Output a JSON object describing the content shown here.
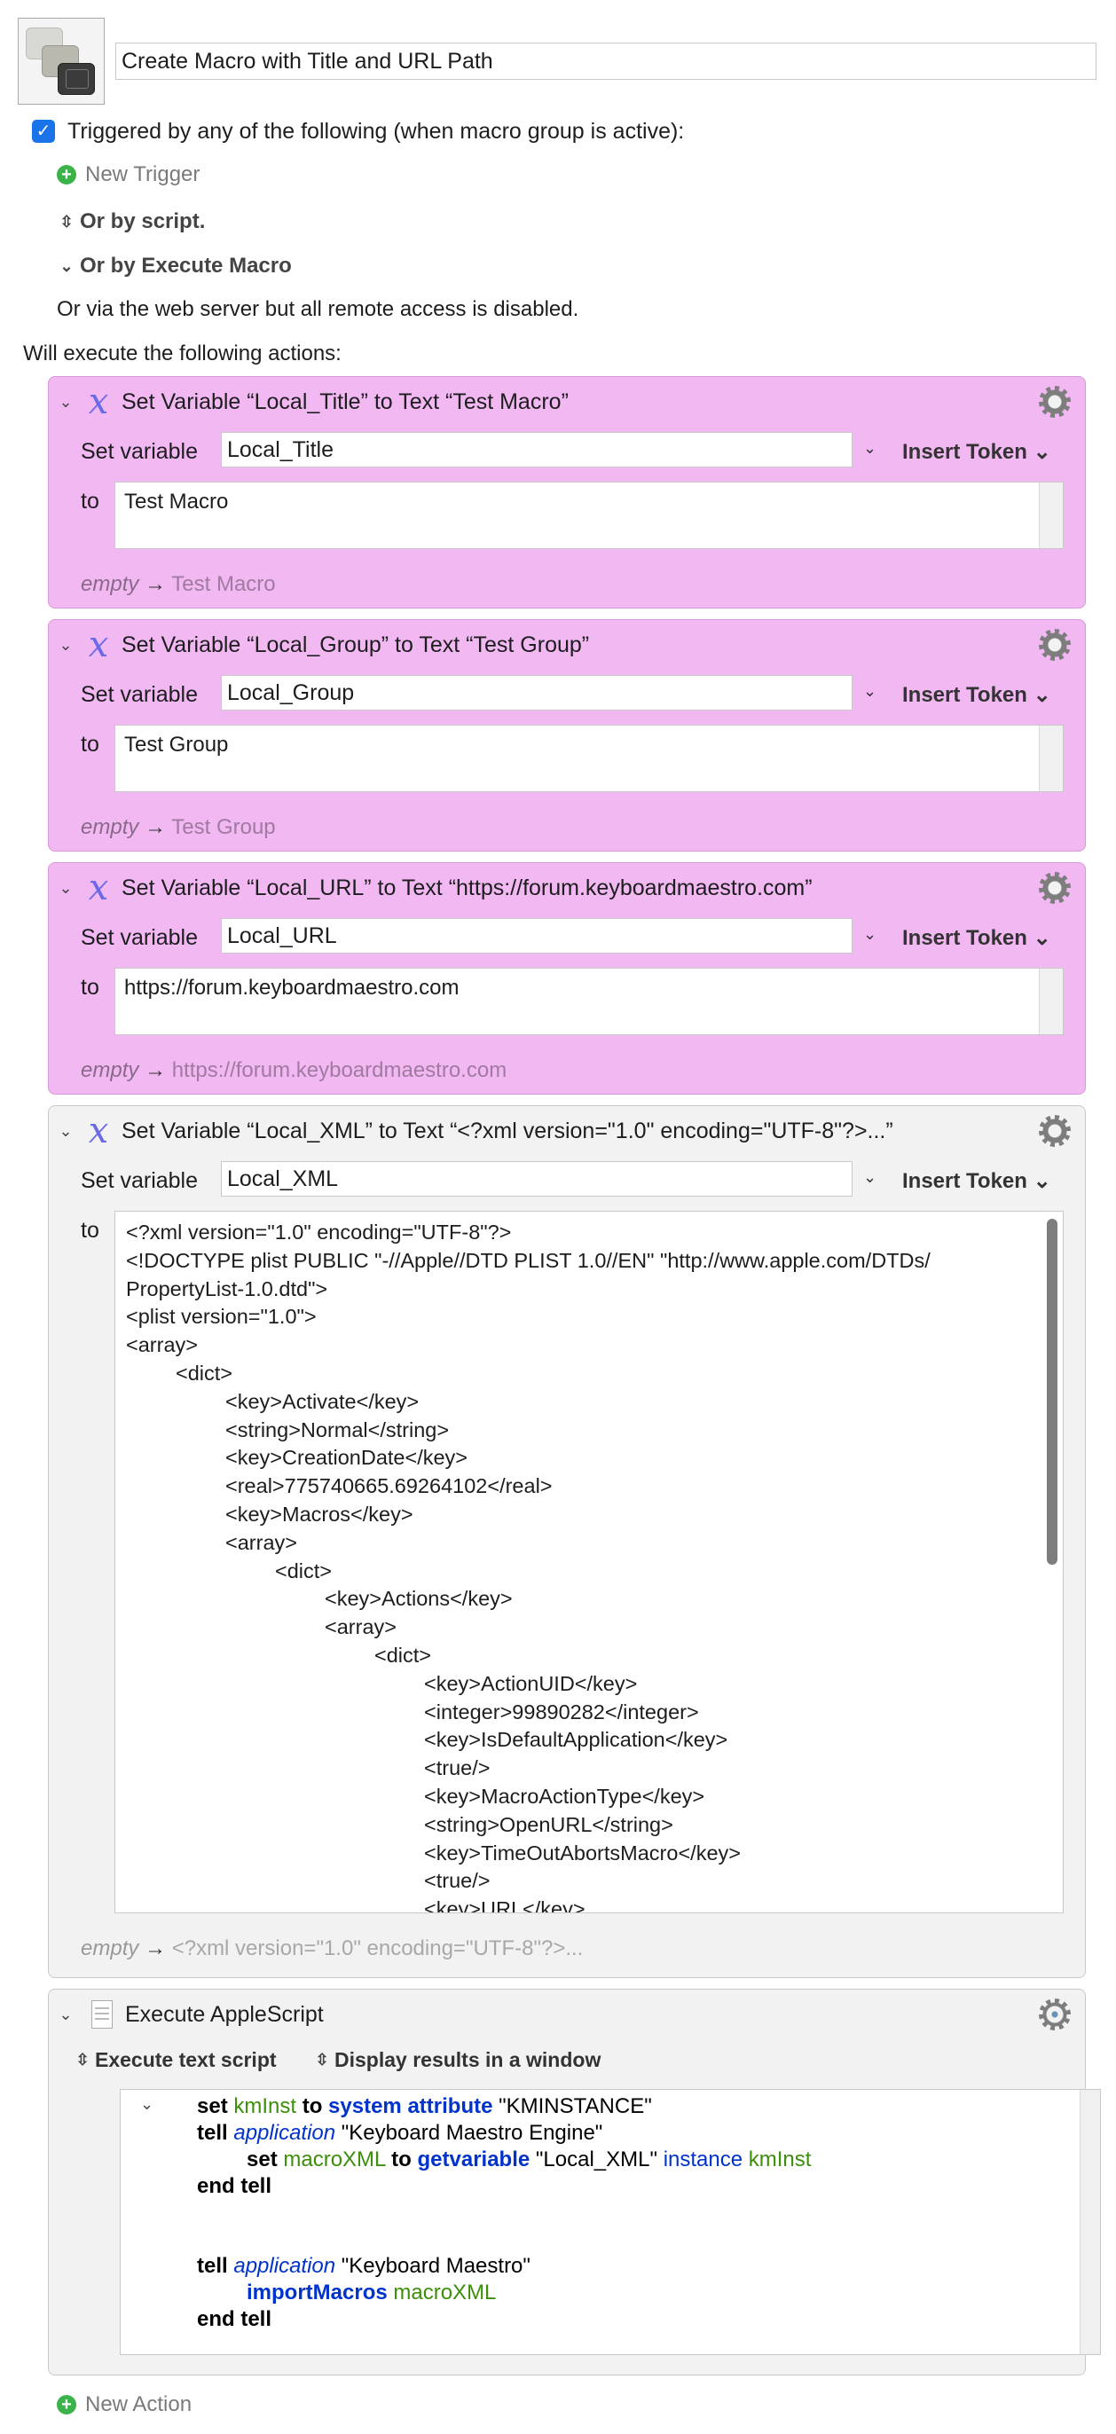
{
  "macro": {
    "title": "Create Macro with Title and URL Path",
    "triggered_label": "Triggered by any of the following (when macro group is active):",
    "new_trigger": "New Trigger",
    "or_by_script": "Or by script.",
    "or_by_execute_macro": "Or by Execute Macro",
    "web_server_note": "Or via the web server but all remote access is disabled.",
    "will_execute": "Will execute the following actions:",
    "new_action": "New Action"
  },
  "labels": {
    "set_variable": "Set variable",
    "to": "to",
    "insert_token": "Insert Token",
    "empty": "empty",
    "arrow": "→"
  },
  "actions": [
    {
      "title": "Set Variable “Local_Title” to Text “Test Macro”",
      "variable": "Local_Title",
      "value": "Test Macro",
      "preview": "Test Macro"
    },
    {
      "title": "Set Variable “Local_Group” to Text “Test Group”",
      "variable": "Local_Group",
      "value": "Test Group",
      "preview": "Test Group"
    },
    {
      "title": "Set Variable “Local_URL” to Text “https://forum.keyboardmaestro.com”",
      "variable": "Local_URL",
      "value": "https://forum.keyboardmaestro.com",
      "preview": "https://forum.keyboardmaestro.com"
    },
    {
      "title": "Set Variable “Local_XML” to Text “<?xml version=\"1.0\" encoding=\"UTF-8\"?>...”",
      "variable": "Local_XML",
      "value_lines": [
        "<?xml version=\"1.0\" encoding=\"UTF-8\"?>",
        "<!DOCTYPE plist PUBLIC \"-//Apple//DTD PLIST 1.0//EN\" \"http://www.apple.com/DTDs/",
        "PropertyList-1.0.dtd\">",
        "<plist version=\"1.0\">",
        "<array>",
        "\t<dict>",
        "\t\t<key>Activate</key>",
        "\t\t<string>Normal</string>",
        "\t\t<key>CreationDate</key>",
        "\t\t<real>775740665.69264102</real>",
        "\t\t<key>Macros</key>",
        "\t\t<array>",
        "\t\t\t<dict>",
        "\t\t\t\t<key>Actions</key>",
        "\t\t\t\t<array>",
        "\t\t\t\t\t<dict>",
        "\t\t\t\t\t\t<key>ActionUID</key>",
        "\t\t\t\t\t\t<integer>99890282</integer>",
        "\t\t\t\t\t\t<key>IsDefaultApplication</key>",
        "\t\t\t\t\t\t<true/>",
        "\t\t\t\t\t\t<key>MacroActionType</key>",
        "\t\t\t\t\t\t<string>OpenURL</string>",
        "\t\t\t\t\t\t<key>TimeOutAbortsMacro</key>",
        "\t\t\t\t\t\t<true/>",
        "\t\t\t\t\t\t<key>URL</key>"
      ],
      "preview": "<?xml version=\"1.0\" encoding=\"UTF-8\"?>..."
    }
  ],
  "applescript": {
    "title": "Execute AppleScript",
    "mode": "Execute text script",
    "result_mode": "Display results in a window",
    "tokens": {
      "set": "set",
      "kmInst": "kmInst",
      "to": "to",
      "system_attribute": "system attribute",
      "kminstance_str": "\"KMINSTANCE\"",
      "tell": "tell",
      "application": "application",
      "engine_str": "\"Keyboard Maestro Engine\"",
      "macroXML": "macroXML",
      "getvariable": "getvariable",
      "local_xml_str": "\"Local_XML\"",
      "instance": "instance",
      "end_tell": "end tell",
      "km_str": "\"Keyboard Maestro\"",
      "importMacros": "importMacros"
    }
  },
  "colors": {
    "action_pink": "#f2b8f2",
    "checkbox_blue": "#1a73e8",
    "add_green": "#3bb34a",
    "keyword_blue": "#0033cc",
    "variable_green": "#3c8f0a"
  },
  "icons": [
    "macro-icon",
    "checkbox-icon",
    "add-icon",
    "updown-chevron-icon",
    "chevron-down-icon",
    "variable-x-icon",
    "gear-icon",
    "gear-clock-icon",
    "applescript-doc-icon"
  ]
}
